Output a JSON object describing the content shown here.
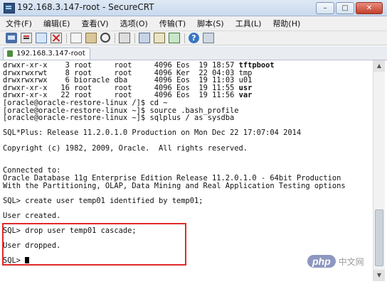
{
  "window": {
    "title": "192.168.3.147-root - SecureCRT",
    "controls": [
      "–",
      "□",
      "✕"
    ]
  },
  "menu": [
    "文件(F)",
    "编辑(E)",
    "查看(V)",
    "选项(O)",
    "传输(T)",
    "脚本(S)",
    "工具(L)",
    "帮助(H)"
  ],
  "toolbar": {
    "icons": [
      "connect-icon",
      "quick-connect-icon",
      "connect-tab-icon",
      "disconnect-icon",
      "copy-icon",
      "paste-icon",
      "find-icon",
      "print-icon",
      "session-options-icon",
      "keymap-icon",
      "sftp-icon",
      "help-icon",
      "more-icon"
    ]
  },
  "tabs": [
    {
      "label": "192.168.3.147-root"
    }
  ],
  "terminal": {
    "ls_rows": [
      {
        "perm": "drwxr-xr-x",
        "links": "3",
        "owner": "root",
        "group": "root",
        "size": "4096",
        "date": "Eos  19 18:57",
        "name": "tftpboot",
        "bold": true
      },
      {
        "perm": "drwxrwxrwt",
        "links": "8",
        "owner": "root",
        "group": "root",
        "size": "4096",
        "date": "Ker  22 04:03",
        "name": "tmp",
        "bold": false
      },
      {
        "perm": "drwxrwxrwx",
        "links": "6",
        "owner": "bioracle",
        "group": "dba",
        "size": "4096",
        "date": "Eos  19 11:03",
        "name": "u01",
        "bold": false
      },
      {
        "perm": "drwxr-xr-x",
        "links": "16",
        "owner": "root",
        "group": "root",
        "size": "4096",
        "date": "Eos  19 11:55",
        "name": "usr",
        "bold": true
      },
      {
        "perm": "drwxr-xr-x",
        "links": "22",
        "owner": "root",
        "group": "root",
        "size": "4096",
        "date": "Eos  19 11:56",
        "name": "var",
        "bold": true
      }
    ],
    "shell_lines": [
      "[oracle@oracle-restore-linux /]$ cd ~",
      "[oracle@oracle-restore-linux ~]$ source .bash_profile",
      "[oracle@oracle-restore-linux ~]$ sqlplus / as sysdba"
    ],
    "sqlplus_banner": "SQL*Plus: Release 11.2.0.1.0 Production on Mon Dec 22 17:07:04 2014",
    "copyright": "Copyright (c) 1982, 2009, Oracle.  All rights reserved.",
    "connected": "Connected to:",
    "db_line1": "Oracle Database 11g Enterprise Edition Release 11.2.0.1.0 - 64bit Production",
    "db_line2": "With the Partitioning, OLAP, Data Mining and Real Application Testing options",
    "cmd_create": "SQL> create user temp01 identified by temp01;",
    "res_create": "User created.",
    "cmd_drop": "SQL> drop user temp01 cascade;",
    "res_drop": "User dropped.",
    "prompt": "SQL> "
  },
  "watermark": {
    "logo": "php",
    "text": "中文网"
  },
  "colors": {
    "highlight": "#e02a2a",
    "titlebar": "#c9d9ee",
    "terminal_bg": "#ffffff"
  }
}
